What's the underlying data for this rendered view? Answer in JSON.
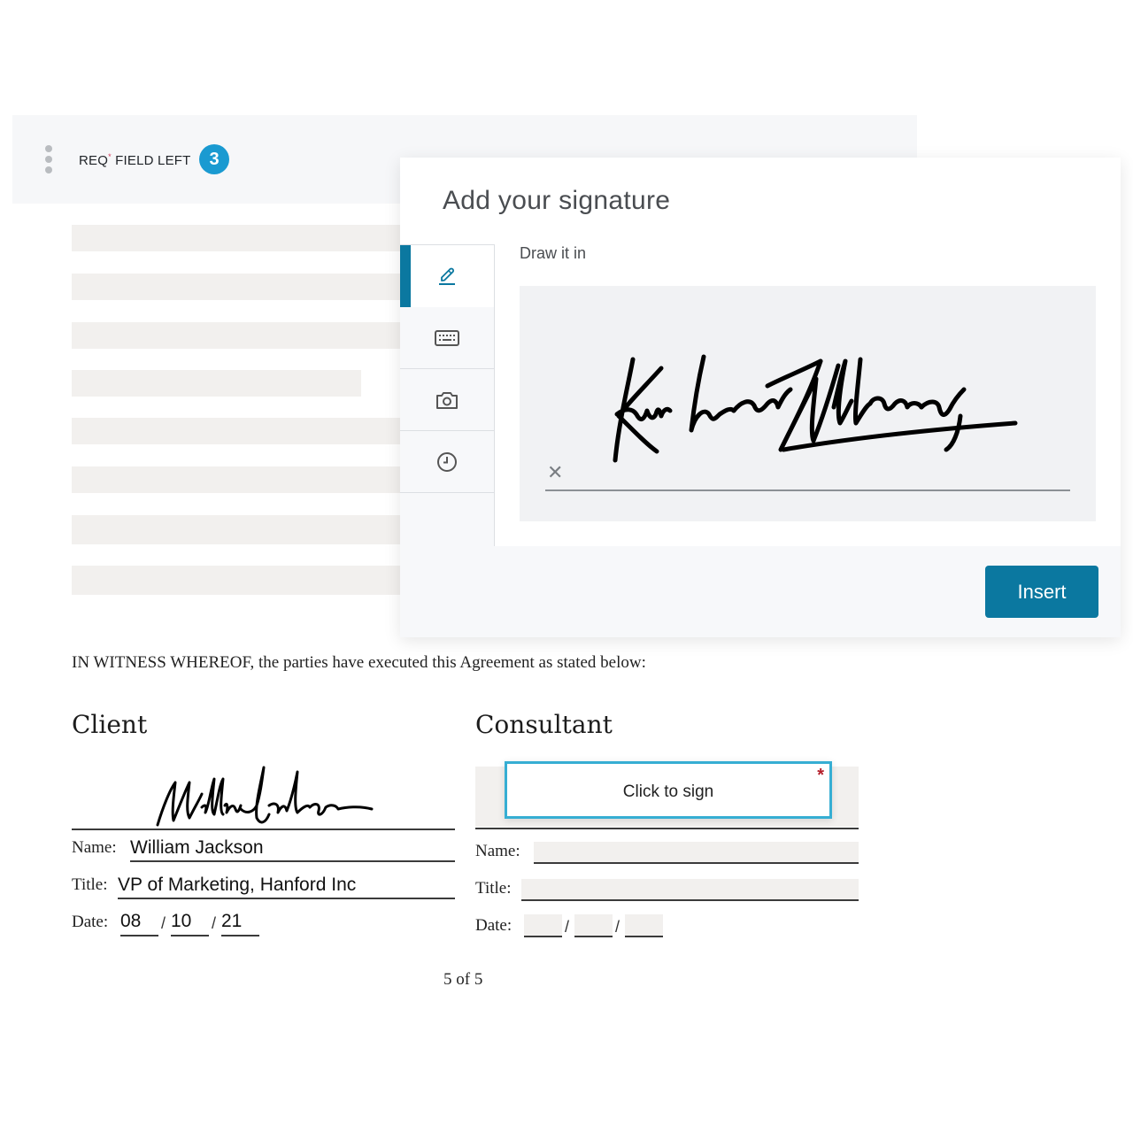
{
  "toolbar": {
    "menu_icon": "kebab-vertical-icon",
    "req_label": "REQ",
    "req_marker": "*",
    "req_suffix": " FIELD LEFT",
    "req_count": "3"
  },
  "document": {
    "placeholder_lines": 8,
    "witness_text": "IN WITNESS WHEREOF, the parties have executed this Agreement as stated below:",
    "client": {
      "heading": "Client",
      "signature": "William Jackson",
      "name_label": "Name:",
      "name_value": "William Jackson",
      "title_label": "Title:",
      "title_value": "VP of Marketing, Hanford Inc",
      "date_label": "Date:",
      "date_month": "08",
      "date_day": "10",
      "date_year": "21",
      "date_sep": "/"
    },
    "consultant": {
      "heading": "Consultant",
      "sign_button": "Click to sign",
      "required_marker": "*",
      "name_label": "Name:",
      "title_label": "Title:",
      "date_label": "Date:",
      "date_sep": "/"
    },
    "page_indicator": "5 of 5"
  },
  "modal": {
    "title": "Add your signature",
    "tabs": [
      {
        "name": "draw",
        "icon": "pencil-icon",
        "active": true
      },
      {
        "name": "type",
        "icon": "keyboard-icon",
        "active": false
      },
      {
        "name": "upload",
        "icon": "camera-icon",
        "active": false
      },
      {
        "name": "recent",
        "icon": "clock-icon",
        "active": false
      }
    ],
    "draw_label": "Draw it in",
    "drawn_signature": "Kimberly Williams",
    "clear_icon": "close-icon",
    "insert_label": "Insert"
  },
  "colors": {
    "accent": "#0b78a0",
    "badge": "#1a9ad1",
    "sign_border": "#36aed3",
    "required": "#b41e2a"
  }
}
